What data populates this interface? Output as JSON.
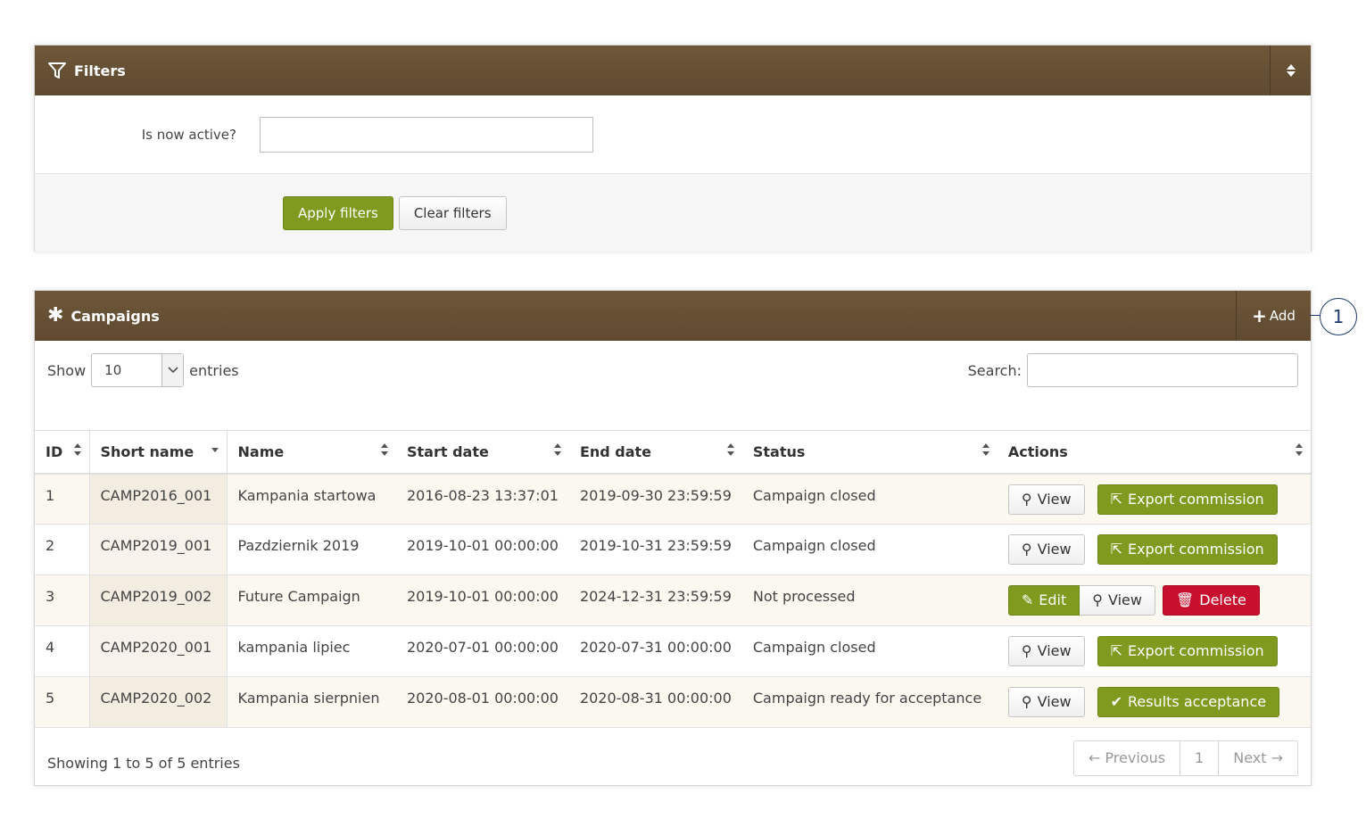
{
  "filters": {
    "title": "Filters",
    "is_active_label": "Is now active?",
    "is_active_value": "",
    "apply_label": "Apply filters",
    "clear_label": "Clear filters"
  },
  "campaigns": {
    "title": "Campaigns",
    "add_label": "Add",
    "show_label": "Show",
    "entries_label": "entries",
    "page_size": "10",
    "search_label": "Search:",
    "search_value": "",
    "columns": [
      "ID",
      "Short name",
      "Name",
      "Start date",
      "End date",
      "Status",
      "Actions"
    ],
    "rows": [
      {
        "id": "1",
        "short": "CAMP2016_001",
        "name": "Kampania startowa",
        "start": "2016-08-23 13:37:01",
        "end": "2019-09-30 23:59:59",
        "status": "Campaign closed"
      },
      {
        "id": "2",
        "short": "CAMP2019_001",
        "name": "Pazdziernik 2019",
        "start": "2019-10-01 00:00:00",
        "end": "2019-10-31 23:59:59",
        "status": "Campaign closed"
      },
      {
        "id": "3",
        "short": "CAMP2019_002",
        "name": "Future Campaign",
        "start": "2019-10-01 00:00:00",
        "end": "2024-12-31 23:59:59",
        "status": "Not processed"
      },
      {
        "id": "4",
        "short": "CAMP2020_001",
        "name": "kampania lipiec",
        "start": "2020-07-01 00:00:00",
        "end": "2020-07-31 00:00:00",
        "status": "Campaign closed"
      },
      {
        "id": "5",
        "short": "CAMP2020_002",
        "name": "Kampania sierpnien",
        "start": "2020-08-01 00:00:00",
        "end": "2020-08-31 00:00:00",
        "status": "Campaign ready for acceptance"
      }
    ],
    "actions": {
      "view": "View",
      "export": "Export commission",
      "edit": "Edit",
      "delete": "Delete",
      "results": "Results acceptance"
    },
    "info": "Showing 1 to 5 of 5 entries",
    "pager": {
      "prev": "← Previous",
      "page": "1",
      "next": "Next →"
    }
  },
  "callout": "1",
  "colors": {
    "header_brown": "#6b5437",
    "olive": "#7f9a1f",
    "danger": "#c8102e",
    "callout_blue": "#1e3a6e"
  }
}
